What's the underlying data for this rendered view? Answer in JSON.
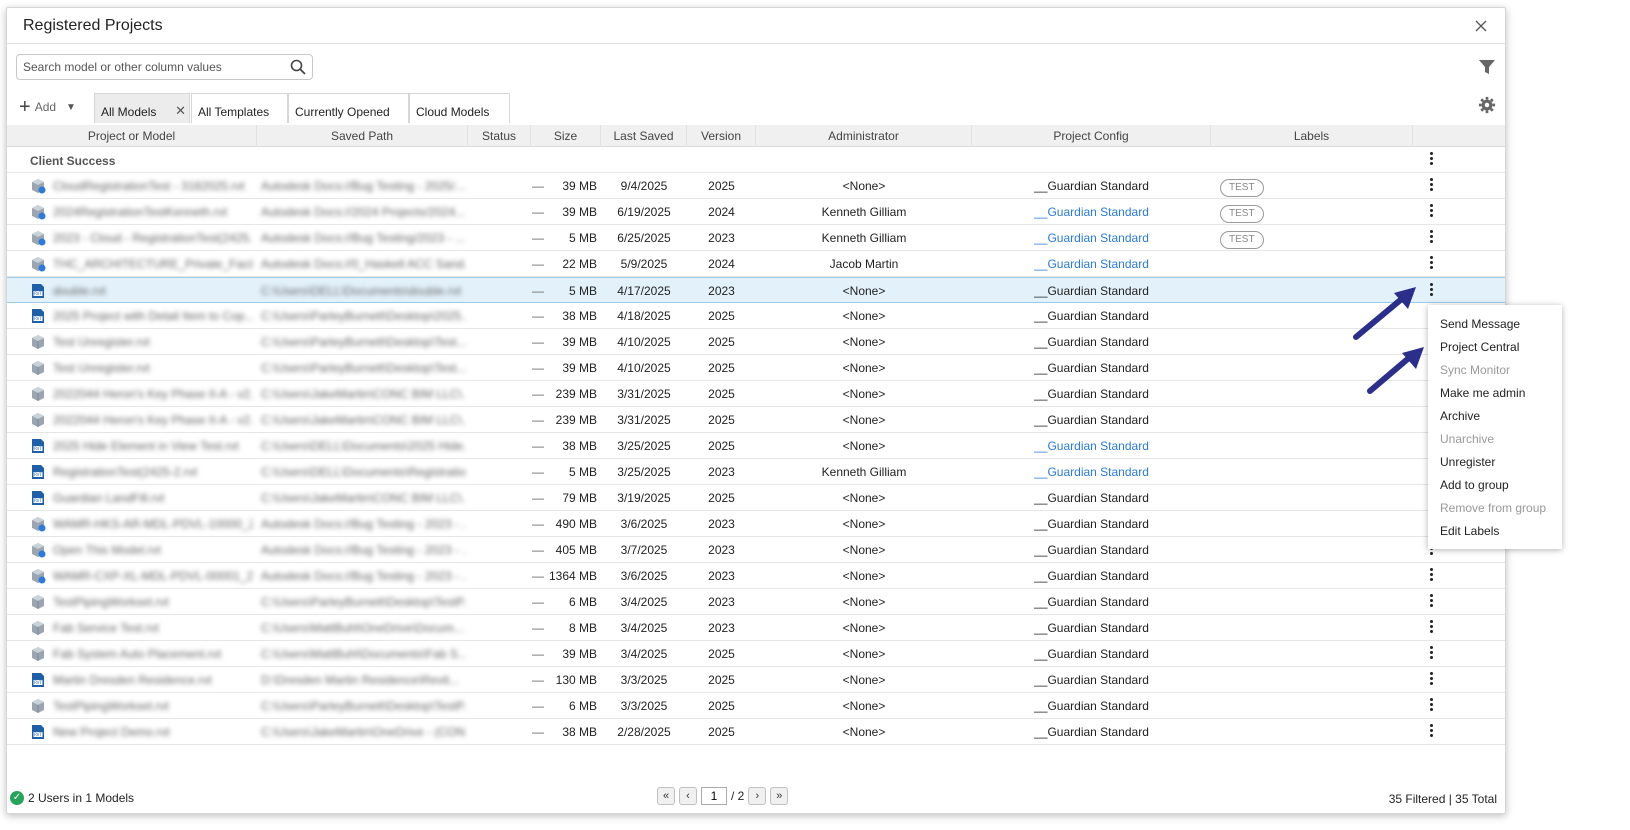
{
  "window": {
    "title": "Registered Projects"
  },
  "search": {
    "placeholder": "Search model or other column values"
  },
  "toolbar": {
    "add_label": "Add"
  },
  "tabs": [
    {
      "label": "All Models",
      "active": true,
      "closable": true
    },
    {
      "label": "All Templates",
      "active": false,
      "closable": false
    },
    {
      "label": "Currently Opened",
      "active": false,
      "closable": false
    },
    {
      "label": "Cloud Models",
      "active": false,
      "closable": false
    }
  ],
  "columns": [
    "Project or Model",
    "Saved Path",
    "Status",
    "Size",
    "Last Saved",
    "Version",
    "Administrator",
    "Project Config",
    "Labels"
  ],
  "group": {
    "label": "Client Success"
  },
  "rows": [
    {
      "icon": "cloud-model-icon",
      "model": "CloudRegistrationTest - 3182025.rvt",
      "path": "Autodesk Docs://Bug Testing - 2025/...",
      "status": "—",
      "size": "39 MB",
      "saved": "9/4/2025",
      "version": "2025",
      "admin": "<None>",
      "config": "__Guardian Standard",
      "config_link": false,
      "label": "TEST",
      "selected": false
    },
    {
      "icon": "cloud-model-icon",
      "model": "2024RegistrationTestKenneth.rvt",
      "path": "Autodesk Docs://2024 Projects/2024...",
      "status": "—",
      "size": "39 MB",
      "saved": "6/19/2025",
      "version": "2024",
      "admin": "Kenneth Gilliam",
      "config": "__Guardian Standard",
      "config_link": true,
      "label": "TEST",
      "selected": false
    },
    {
      "icon": "cloud-model-icon",
      "model": "2023 - Cloud - RegistrationTest(2425...",
      "path": "Autodesk Docs://Bug Testing/2023 - ...",
      "status": "—",
      "size": "5 MB",
      "saved": "6/25/2025",
      "version": "2023",
      "admin": "Kenneth Gilliam",
      "config": "__Guardian Standard",
      "config_link": true,
      "label": "TEST",
      "selected": false
    },
    {
      "icon": "cloud-model-icon",
      "model": "THC_ARCHITECTURE_Private_Faciliti...",
      "path": "Autodesk Docs://0_Haskell ACC Sand...",
      "status": "—",
      "size": "22 MB",
      "saved": "5/9/2025",
      "version": "2024",
      "admin": "Jacob Martin",
      "config": "__Guardian Standard",
      "config_link": true,
      "label": "",
      "selected": false
    },
    {
      "icon": "rvt-file-icon",
      "model": "double.rvt",
      "path": "C:\\Users\\DELL\\Documents\\double.rvt",
      "status": "—",
      "size": "5 MB",
      "saved": "4/17/2025",
      "version": "2023",
      "admin": "<None>",
      "config": "__Guardian Standard",
      "config_link": false,
      "label": "",
      "selected": true
    },
    {
      "icon": "rvt-file-icon",
      "model": "2025 Project with Detail Item to Cop...",
      "path": "C:\\Users\\ParleyBurnett\\Desktop\\2025...",
      "status": "—",
      "size": "38 MB",
      "saved": "4/18/2025",
      "version": "2025",
      "admin": "<None>",
      "config": "__Guardian Standard",
      "config_link": false,
      "label": "",
      "selected": false
    },
    {
      "icon": "central-model-icon",
      "model": "Test Unregister.rvt",
      "path": "C:\\Users\\ParleyBurnett\\Desktop\\Test...",
      "status": "—",
      "size": "39 MB",
      "saved": "4/10/2025",
      "version": "2025",
      "admin": "<None>",
      "config": "__Guardian Standard",
      "config_link": false,
      "label": "",
      "selected": false
    },
    {
      "icon": "central-model-icon",
      "model": "Test Unregister.rvt",
      "path": "C:\\Users\\ParleyBurnett\\Desktop\\Test...",
      "status": "—",
      "size": "39 MB",
      "saved": "4/10/2025",
      "version": "2025",
      "admin": "<None>",
      "config": "__Guardian Standard",
      "config_link": false,
      "label": "",
      "selected": false
    },
    {
      "icon": "central-model-icon",
      "model": "2022044 Heron's Key Phase II-A - v2...",
      "path": "C:\\Users\\JakeMartin\\CONC BIM LLC\\...",
      "status": "—",
      "size": "239 MB",
      "saved": "3/31/2025",
      "version": "2025",
      "admin": "<None>",
      "config": "__Guardian Standard",
      "config_link": false,
      "label": "",
      "selected": false
    },
    {
      "icon": "central-model-icon",
      "model": "2022044 Heron's Key Phase II-A - v2...",
      "path": "C:\\Users\\JakeMartin\\CONC BIM LLC\\...",
      "status": "—",
      "size": "239 MB",
      "saved": "3/31/2025",
      "version": "2025",
      "admin": "<None>",
      "config": "__Guardian Standard",
      "config_link": false,
      "label": "",
      "selected": false
    },
    {
      "icon": "rvt-file-icon",
      "model": "2025 Hide Element in View Test.rvt",
      "path": "C:\\Users\\DELL\\Documents\\2025 Hide...",
      "status": "—",
      "size": "38 MB",
      "saved": "3/25/2025",
      "version": "2025",
      "admin": "<None>",
      "config": "__Guardian Standard",
      "config_link": true,
      "label": "",
      "selected": false
    },
    {
      "icon": "rvt-file-icon",
      "model": "RegistrationTest(2425-2.rvt",
      "path": "C:\\Users\\DELL\\Documents\\Registratio...",
      "status": "—",
      "size": "5 MB",
      "saved": "3/25/2025",
      "version": "2023",
      "admin": "Kenneth Gilliam",
      "config": "__Guardian Standard",
      "config_link": true,
      "label": "",
      "selected": false
    },
    {
      "icon": "rvt-file-icon",
      "model": "Guardian LandFill.rvt",
      "path": "C:\\Users\\JakeMartin\\CONC BIM LLC\\...",
      "status": "—",
      "size": "79 MB",
      "saved": "3/19/2025",
      "version": "2025",
      "admin": "<None>",
      "config": "__Guardian Standard",
      "config_link": false,
      "label": "",
      "selected": false
    },
    {
      "icon": "cloud-model-icon",
      "model": "WAMR-HKS-AR-MDL-PDVL-10000_20...",
      "path": "Autodesk Docs://Bug Testing - 2023 - ...",
      "status": "—",
      "size": "490 MB",
      "saved": "3/6/2025",
      "version": "2023",
      "admin": "<None>",
      "config": "__Guardian Standard",
      "config_link": false,
      "label": "",
      "selected": false
    },
    {
      "icon": "cloud-model-icon",
      "model": "Open This Model.rvt",
      "path": "Autodesk Docs://Bug Testing - 2023 - ...",
      "status": "—",
      "size": "405 MB",
      "saved": "3/7/2025",
      "version": "2023",
      "admin": "<None>",
      "config": "__Guardian Standard",
      "config_link": false,
      "label": "",
      "selected": false
    },
    {
      "icon": "cloud-model-icon",
      "model": "WAMR-CXP-XL-MDL-PDVL-00001_20...",
      "path": "Autodesk Docs://Bug Testing - 2023 - ...",
      "status": "—",
      "size": "1364 MB",
      "saved": "3/6/2025",
      "version": "2023",
      "admin": "<None>",
      "config": "__Guardian Standard",
      "config_link": false,
      "label": "",
      "selected": false
    },
    {
      "icon": "central-model-icon",
      "model": "TestPipingWorkset.rvt",
      "path": "C:\\Users\\ParleyBurnett\\Desktop\\TestP...",
      "status": "—",
      "size": "6 MB",
      "saved": "3/4/2025",
      "version": "2023",
      "admin": "<None>",
      "config": "__Guardian Standard",
      "config_link": false,
      "label": "",
      "selected": false
    },
    {
      "icon": "central-model-icon",
      "model": "Fab Service Test.rvt",
      "path": "C:\\Users\\MattBuhl\\OneDrive\\Docum...",
      "status": "—",
      "size": "8 MB",
      "saved": "3/4/2025",
      "version": "2023",
      "admin": "<None>",
      "config": "__Guardian Standard",
      "config_link": false,
      "label": "",
      "selected": false
    },
    {
      "icon": "central-model-icon",
      "model": "Fab System Auto Placement.rvt",
      "path": "C:\\Users\\MattBuhl\\Documents\\Fab S...",
      "status": "—",
      "size": "39 MB",
      "saved": "3/4/2025",
      "version": "2025",
      "admin": "<None>",
      "config": "__Guardian Standard",
      "config_link": false,
      "label": "",
      "selected": false
    },
    {
      "icon": "rvt-file-icon",
      "model": "Martin Dresden Residence.rvt",
      "path": "D:\\Dresden Martin Residence\\Revit...",
      "status": "—",
      "size": "130 MB",
      "saved": "3/3/2025",
      "version": "2025",
      "admin": "<None>",
      "config": "__Guardian Standard",
      "config_link": false,
      "label": "",
      "selected": false
    },
    {
      "icon": "central-model-icon",
      "model": "TestPipingWorkset.rvt",
      "path": "C:\\Users\\ParleyBurnett\\Desktop\\TestP...",
      "status": "—",
      "size": "6 MB",
      "saved": "3/3/2025",
      "version": "2025",
      "admin": "<None>",
      "config": "__Guardian Standard",
      "config_link": false,
      "label": "",
      "selected": false
    },
    {
      "icon": "rvt-file-icon",
      "model": "New Project Demo.rvt",
      "path": "C:\\Users\\JakeMartin\\OneDrive - (CON...",
      "status": "—",
      "size": "38 MB",
      "saved": "2/28/2025",
      "version": "2025",
      "admin": "<None>",
      "config": "__Guardian Standard",
      "config_link": false,
      "label": "",
      "selected": false
    }
  ],
  "context_menu": [
    {
      "label": "Send Message",
      "enabled": true
    },
    {
      "label": "Project Central",
      "enabled": true
    },
    {
      "label": "Sync Monitor",
      "enabled": false
    },
    {
      "label": "Make me admin",
      "enabled": true
    },
    {
      "label": "Archive",
      "enabled": true
    },
    {
      "label": "Unarchive",
      "enabled": false
    },
    {
      "label": "Unregister",
      "enabled": true
    },
    {
      "label": "Add to group",
      "enabled": true
    },
    {
      "label": "Remove from group",
      "enabled": false
    },
    {
      "label": "Edit Labels",
      "enabled": true
    }
  ],
  "footer": {
    "status_text": "2 Users in 1 Models",
    "page_current": "1",
    "page_total": "/ 2",
    "totals": "35 Filtered | 35 Total"
  },
  "colors": {
    "accent": "#2c7bd6",
    "selected_row": "#e3f1fb",
    "annotation_arrow": "#2b2f8a",
    "ok": "#27a35a"
  }
}
